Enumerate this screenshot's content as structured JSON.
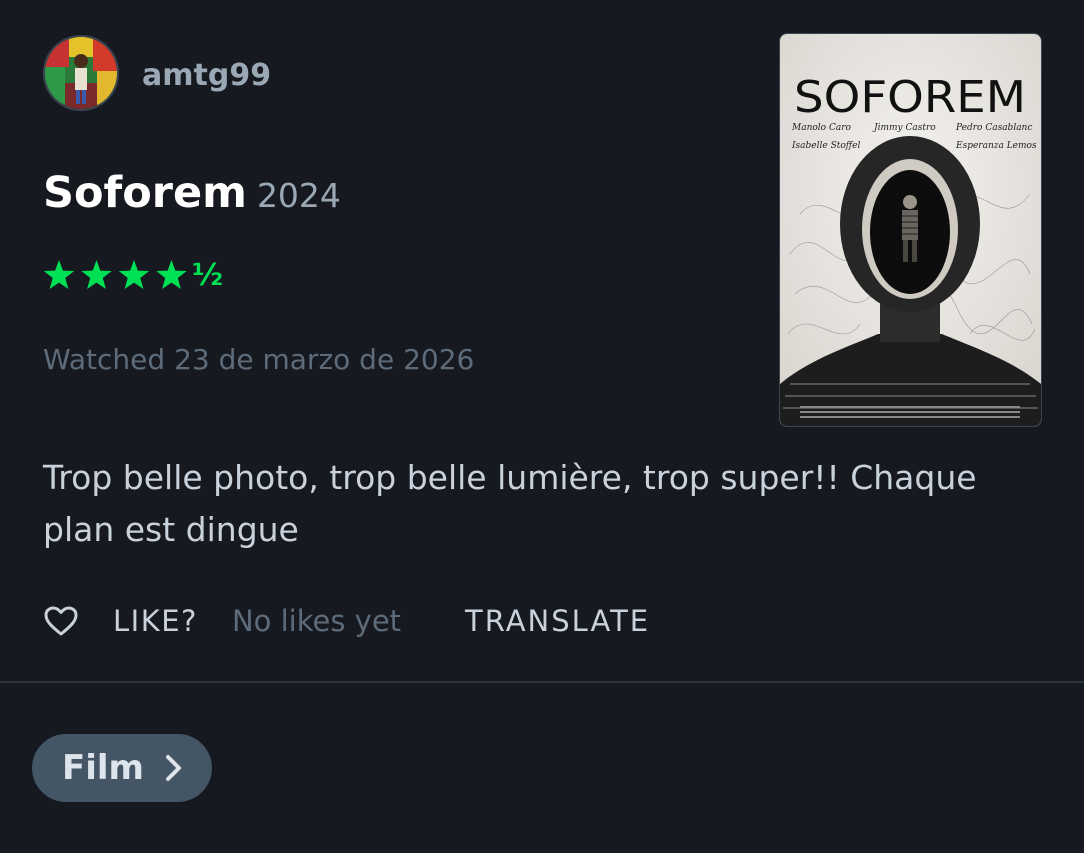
{
  "review": {
    "username": "amtg99",
    "film_title": "Soforem",
    "film_year": "2024",
    "rating_stars": 4.5,
    "rating_max": 5,
    "rating_half_glyph": "½",
    "watched_text": "Watched 23 de marzo de 2026",
    "body": "Trop belle photo, trop belle lumière, trop super!! Chaque plan est dingue"
  },
  "poster": {
    "title": "SOFOREM",
    "cast_row1": [
      "Manolo Caro",
      "Jimmy Castro",
      "Pedro Casablanc"
    ],
    "cast_row2": [
      "Isabelle Stoffel",
      "Esperanza Lemos"
    ]
  },
  "actions": {
    "like_label": "LIKE?",
    "likes_count": "No likes yet",
    "translate_label": "TRANSLATE"
  },
  "footer": {
    "film_link_label": "Film"
  },
  "colors": {
    "background": "#16191f",
    "star_green": "#00e054",
    "pill": "#445566"
  }
}
